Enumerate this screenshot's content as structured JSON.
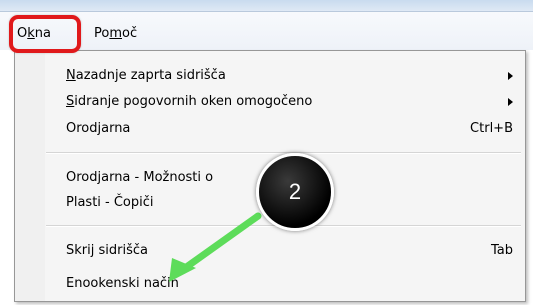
{
  "menubar": {
    "items": [
      {
        "pre": "O",
        "underline": "k",
        "post": "na"
      },
      {
        "pre": "Po",
        "underline": "m",
        "post": "oč"
      }
    ]
  },
  "dropdown": {
    "items": [
      {
        "pre": "",
        "underline": "N",
        "post": "azadnje zaprta sidrišča",
        "shortcut": "",
        "submenu": true
      },
      {
        "pre": "",
        "underline": "S",
        "post": "idranje pogovornih oken omogočeno",
        "shortcut": "",
        "submenu": true
      },
      {
        "pre": "Orodjarna",
        "underline": "",
        "post": "",
        "shortcut": "Ctrl+B",
        "submenu": false
      },
      {
        "pre": "Orodjarna - Možnosti o",
        "underline": "",
        "post": "",
        "shortcut": "",
        "submenu": false
      },
      {
        "pre": "Plasti - Čopiči",
        "underline": "",
        "post": "",
        "shortcut": "",
        "submenu": false
      },
      {
        "pre": "Skrij sidrišča",
        "underline": "",
        "post": "",
        "shortcut": "Tab",
        "submenu": false
      },
      {
        "pre": "Enookenski način",
        "underline": "",
        "post": "",
        "shortcut": "",
        "submenu": false
      }
    ]
  },
  "annotation": {
    "step_number": "2",
    "highlight_color": "#e0191b",
    "arrow_color": "#5ddc5a"
  }
}
